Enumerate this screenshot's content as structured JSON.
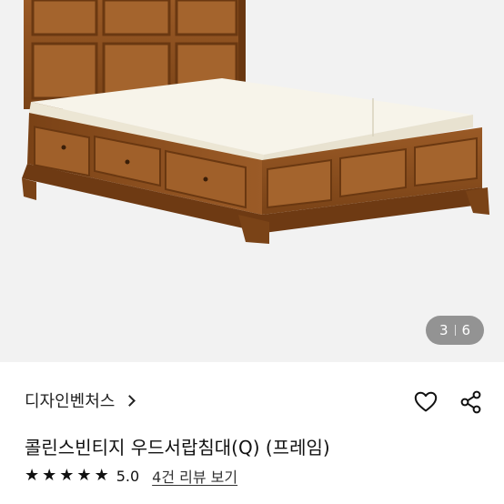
{
  "product": {
    "pager": {
      "current": "3",
      "total": "6"
    },
    "shop_name": "디자인벤처스",
    "title": "콜린스빈티지 우드서랍침대(Q) (프레임)",
    "rating": {
      "stars": 5,
      "score": "5.0",
      "reviews_link": "4건 리뷰 보기"
    }
  },
  "icons": {
    "shop_chevron": "chevron-right-icon",
    "like": "heart-outline-icon",
    "share": "share-icon",
    "star": "star-icon"
  },
  "colors": {
    "wood": "#8a4f1f",
    "wood_dark": "#6a3811",
    "mattress": "#f4f1e6",
    "background": "#f2f2f2"
  }
}
